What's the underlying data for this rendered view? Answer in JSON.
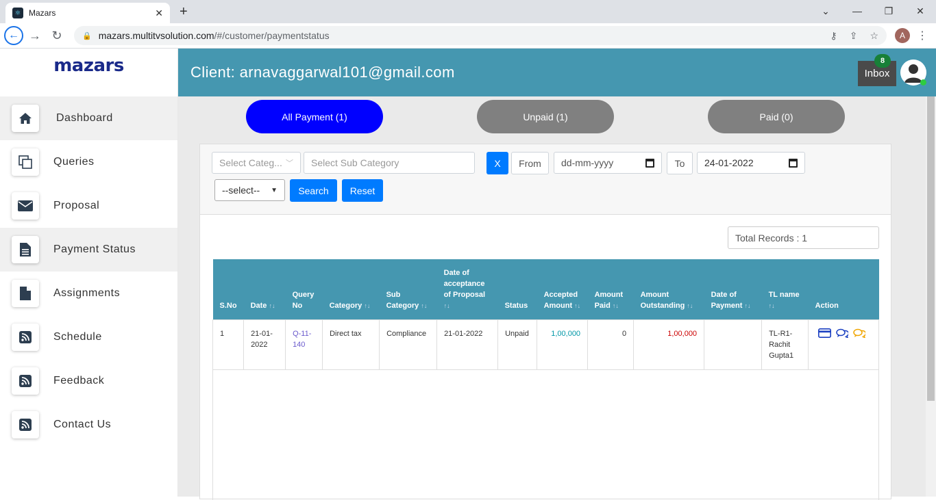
{
  "browser": {
    "tab_title": "Mazars",
    "url_host": "mazars.multitvsolution.com",
    "url_path": "/#/customer/paymentstatus",
    "profile_initial": "A"
  },
  "sidebar": {
    "logo": "mazars",
    "items": [
      {
        "label": "Dashboard",
        "icon": "home-icon"
      },
      {
        "label": "Queries",
        "icon": "copy-icon"
      },
      {
        "label": "Proposal",
        "icon": "envelope-icon"
      },
      {
        "label": "Payment Status",
        "icon": "document-icon"
      },
      {
        "label": "Assignments",
        "icon": "file-icon"
      },
      {
        "label": "Schedule",
        "icon": "rss-icon"
      },
      {
        "label": "Feedback",
        "icon": "rss-icon"
      },
      {
        "label": "Contact Us",
        "icon": "rss-icon"
      }
    ]
  },
  "header": {
    "client": "Client: arnavaggarwal101@gmail.com",
    "inbox_label": "Inbox",
    "inbox_count": "8"
  },
  "pills": {
    "all": "All Payment (1)",
    "unpaid": "Unpaid (1)",
    "paid": "Paid (0)"
  },
  "filters": {
    "category_placeholder": "Select Categ...",
    "subcategory_placeholder": "Select Sub Category",
    "clear_label": "X",
    "from_label": "From",
    "from_date_placeholder": "dd-mm-yyyy",
    "to_label": "To",
    "to_date_value": "24-01-2022",
    "status_select": "--select--",
    "search_label": "Search",
    "reset_label": "Reset"
  },
  "total_records": "Total Records : 1",
  "table": {
    "headers": [
      "S.No",
      "Date",
      "Query No",
      "Category",
      "Sub Category",
      "Date of acceptance of Proposal",
      "Status",
      "Accepted Amount",
      "Amount Paid",
      "Amount Outstanding",
      "Date of Payment",
      "TL name",
      "Action"
    ],
    "rows": [
      {
        "sno": "1",
        "date": "21-01-2022",
        "query_no": "Q-11-140",
        "category": "Direct tax",
        "sub_category": "Compliance",
        "acceptance_date": "21-01-2022",
        "status": "Unpaid",
        "accepted_amount": "1,00,000",
        "amount_paid": "0",
        "amount_outstanding": "1,00,000",
        "payment_date": "",
        "tl_name": "TL-R1-Rachit Gupta1"
      }
    ]
  }
}
